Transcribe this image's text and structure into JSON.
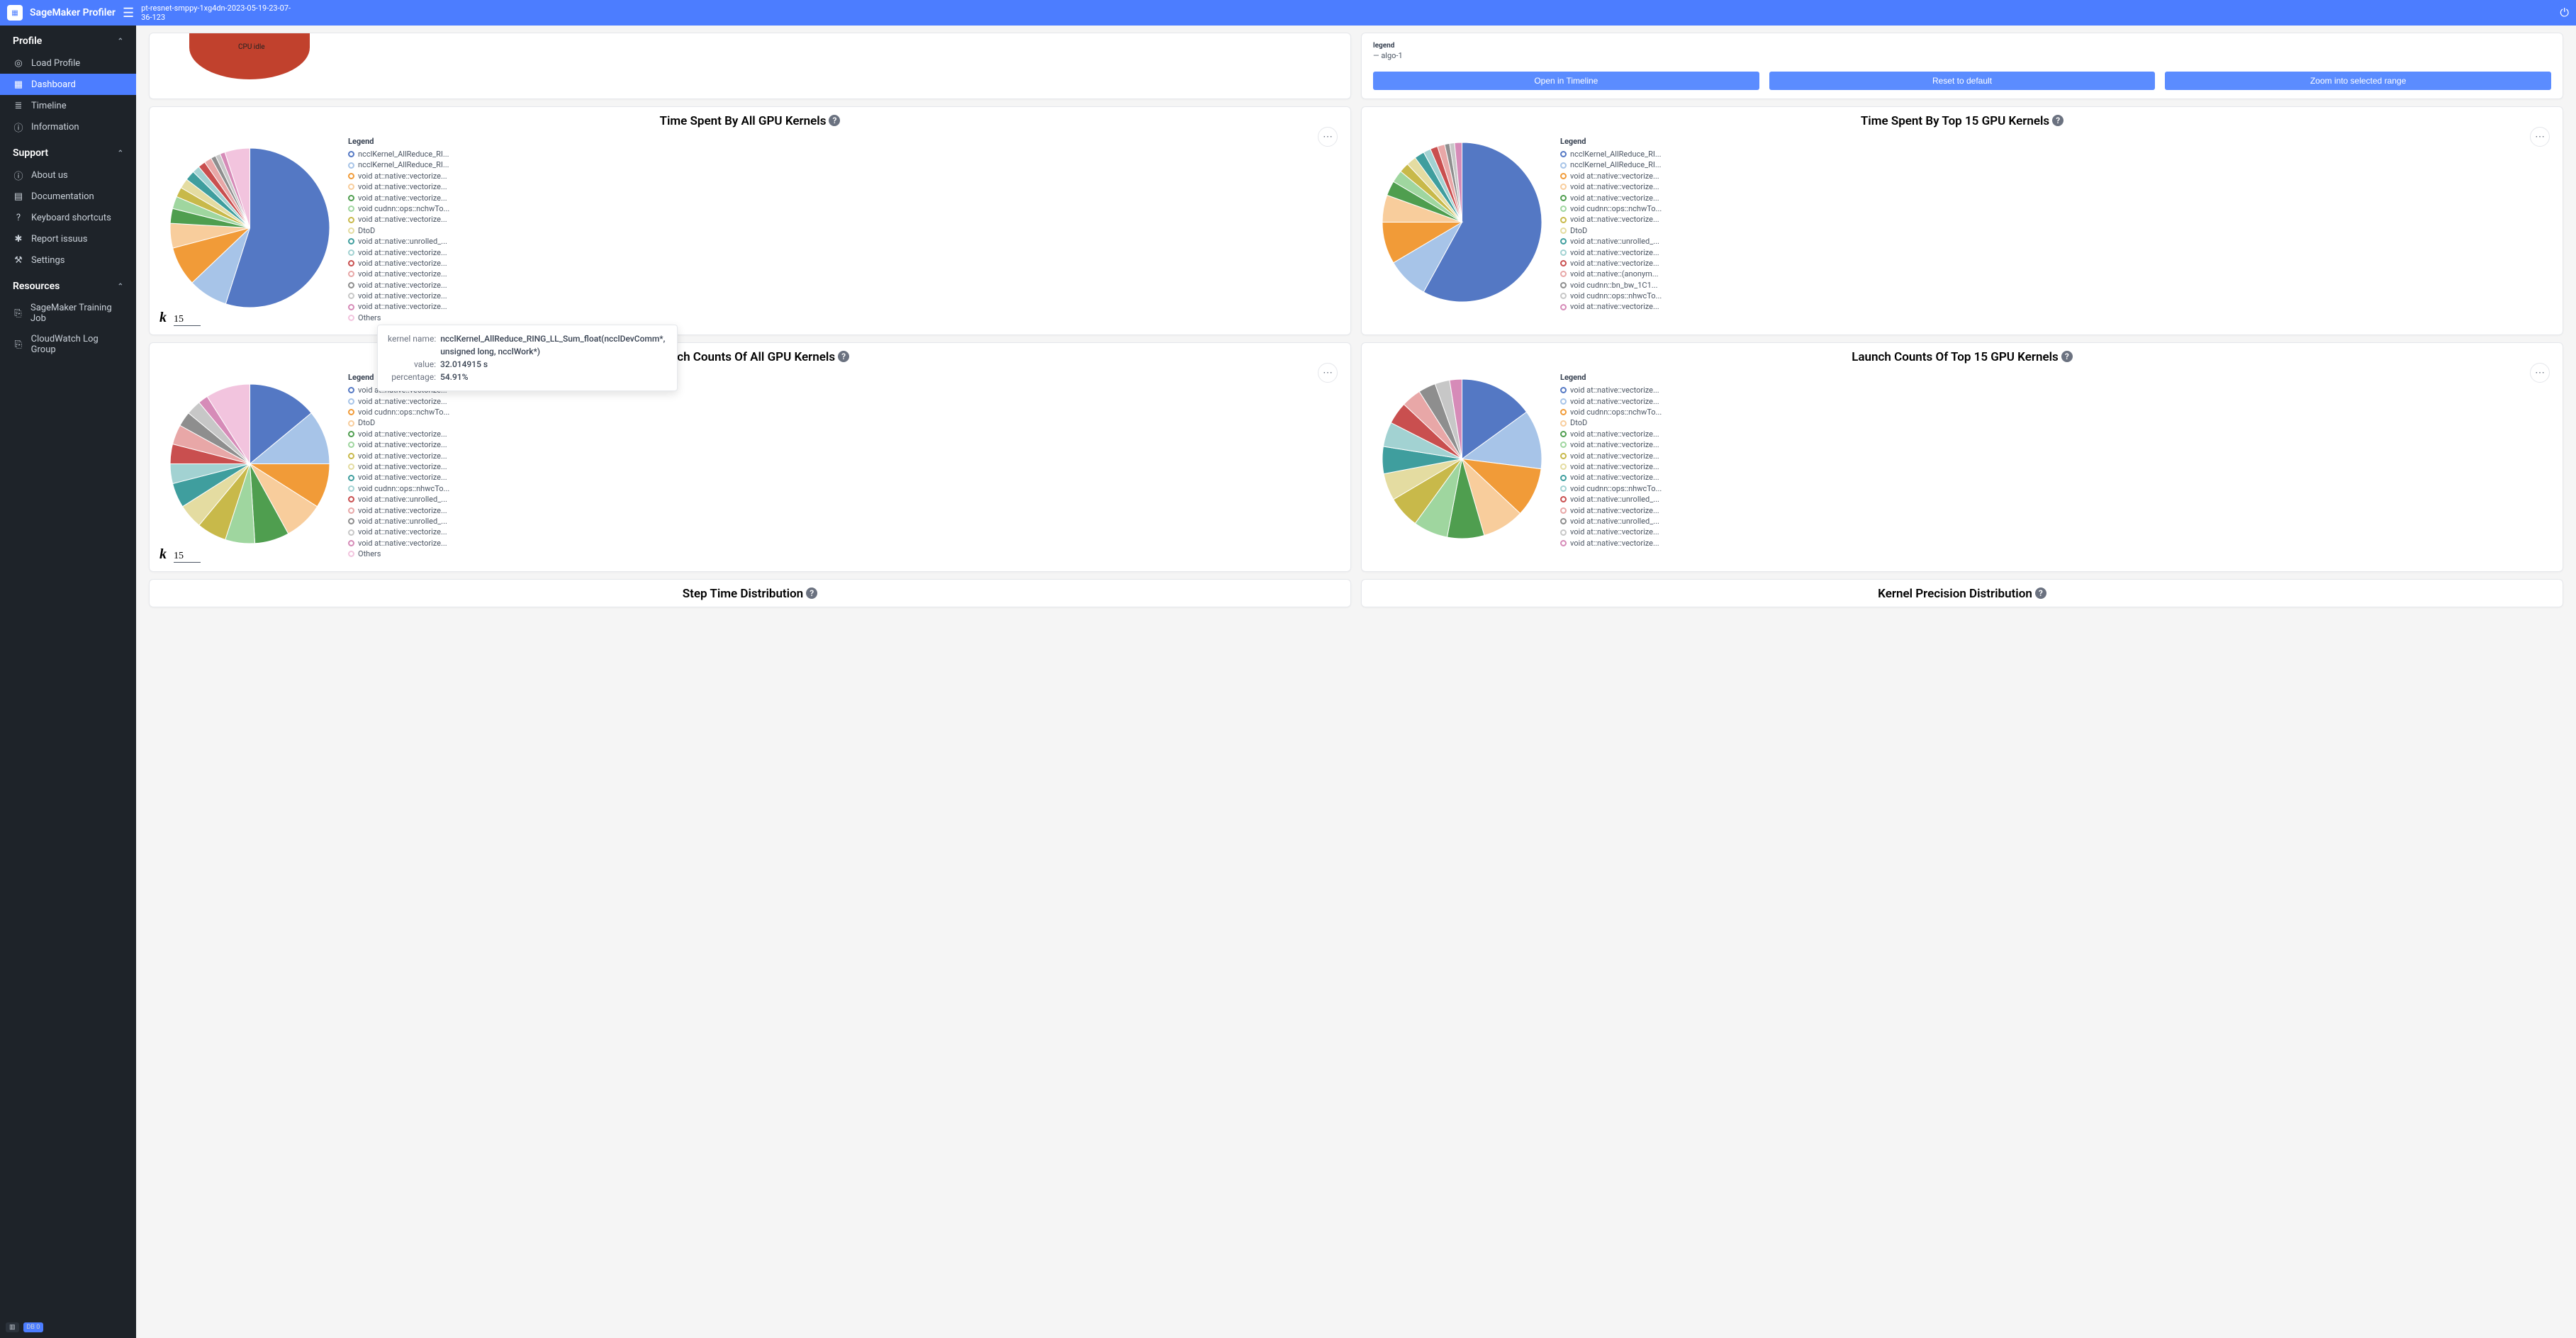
{
  "header": {
    "app_title": "SageMaker Profiler",
    "job_name": "pt-resnet-smppy-1xg4dn-2023-05-19-23-07-36-123"
  },
  "sidebar": {
    "sections": {
      "profile": "Profile",
      "support": "Support",
      "resources": "Resources"
    },
    "profile_items": [
      {
        "label": "Load Profile",
        "icon": "◎"
      },
      {
        "label": "Dashboard",
        "icon": "▦",
        "active": true
      },
      {
        "label": "Timeline",
        "icon": "≣"
      },
      {
        "label": "Information",
        "icon": "ⓘ"
      }
    ],
    "support_items": [
      {
        "label": "About us",
        "icon": "ⓘ"
      },
      {
        "label": "Documentation",
        "icon": "▤"
      },
      {
        "label": "Keyboard shortcuts",
        "icon": "?"
      },
      {
        "label": "Report issuus",
        "icon": "✱"
      },
      {
        "label": "Settings",
        "icon": "⚒"
      }
    ],
    "resource_items": [
      {
        "label": "SageMaker Training Job",
        "icon": "⎘"
      },
      {
        "label": "CloudWatch Log Group",
        "icon": "⎘"
      }
    ],
    "footer_db": "DB 0"
  },
  "top_left": {
    "cpu_label": "CPU idle"
  },
  "top_right": {
    "legend_title": "legend",
    "legend_item": "algo-1",
    "buttons": {
      "open": "Open in Timeline",
      "reset": "Reset to default",
      "zoom": "Zoom into selected range"
    }
  },
  "tooltip": {
    "rows": [
      {
        "label": "kernel name:",
        "value": "ncclKernel_AllReduce_RING_LL_Sum_float(ncclDevComm*, unsigned long, ncclWork*)"
      },
      {
        "label": "value:",
        "value": "32.014915 s"
      },
      {
        "label": "percentage:",
        "value": "54.91%"
      }
    ]
  },
  "charts": [
    {
      "id": "time-all",
      "title": "Time Spent By All GPU Kernels",
      "k_value": "15",
      "show_k": true,
      "show_others": true,
      "chart_data": {
        "type": "pie",
        "title": "Time Spent By All GPU Kernels",
        "series": [
          {
            "name": "ncclKernel_AllReduce_RI...",
            "value": 54.91,
            "color": "#5478c4"
          },
          {
            "name": "ncclKernel_AllReduce_RI...",
            "value": 8.0,
            "color": "#a7c4e8"
          },
          {
            "name": "void at::native::vectorize...",
            "value": 8.0,
            "color": "#f19b38"
          },
          {
            "name": "void at::native::vectorize...",
            "value": 5.0,
            "color": "#f8cd9c"
          },
          {
            "name": "void at::native::vectorize...",
            "value": 3.0,
            "color": "#4f9e4f"
          },
          {
            "name": "void cudnn::ops::nchwTo...",
            "value": 2.5,
            "color": "#9fd69f"
          },
          {
            "name": "void at::native::vectorize...",
            "value": 2.0,
            "color": "#c8b94a"
          },
          {
            "name": "DtoD",
            "value": 2.0,
            "color": "#e4dca1"
          },
          {
            "name": "void at::native::unrolled_...",
            "value": 2.0,
            "color": "#3f9e9e"
          },
          {
            "name": "void at::native::vectorize...",
            "value": 1.5,
            "color": "#a2d2d2"
          },
          {
            "name": "void at::native::vectorize...",
            "value": 1.5,
            "color": "#c94f4f"
          },
          {
            "name": "void at::native::vectorize...",
            "value": 1.5,
            "color": "#e8a7a7"
          },
          {
            "name": "void at::native::vectorize...",
            "value": 1.0,
            "color": "#8e8e8e"
          },
          {
            "name": "void at::native::vectorize...",
            "value": 1.0,
            "color": "#c7c7c7"
          },
          {
            "name": "void at::native::vectorize...",
            "value": 1.0,
            "color": "#d68bb8"
          },
          {
            "name": "Others",
            "value": 5.09,
            "color": "#f2c4de"
          }
        ]
      }
    },
    {
      "id": "time-top15",
      "title": "Time Spent By Top 15 GPU Kernels",
      "show_k": false,
      "show_others": false,
      "chart_data": {
        "type": "pie",
        "title": "Time Spent By Top 15 GPU Kernels",
        "series": [
          {
            "name": "ncclKernel_AllReduce_RI...",
            "value": 58.0,
            "color": "#5478c4"
          },
          {
            "name": "ncclKernel_AllReduce_RI...",
            "value": 8.5,
            "color": "#a7c4e8"
          },
          {
            "name": "void at::native::vectorize...",
            "value": 8.5,
            "color": "#f19b38"
          },
          {
            "name": "void at::native::vectorize...",
            "value": 5.5,
            "color": "#f8cd9c"
          },
          {
            "name": "void at::native::vectorize...",
            "value": 3.0,
            "color": "#4f9e4f"
          },
          {
            "name": "void cudnn::ops::nchwTo...",
            "value": 2.5,
            "color": "#9fd69f"
          },
          {
            "name": "void at::native::vectorize...",
            "value": 2.0,
            "color": "#c8b94a"
          },
          {
            "name": "DtoD",
            "value": 2.0,
            "color": "#e4dca1"
          },
          {
            "name": "void at::native::unrolled_...",
            "value": 2.0,
            "color": "#3f9e9e"
          },
          {
            "name": "void at::native::vectorize...",
            "value": 1.5,
            "color": "#a2d2d2"
          },
          {
            "name": "void at::native::vectorize...",
            "value": 1.5,
            "color": "#c94f4f"
          },
          {
            "name": "void at::native::(anonym...",
            "value": 1.5,
            "color": "#e8a7a7"
          },
          {
            "name": "void cudnn::bn_bw_1C1...",
            "value": 1.0,
            "color": "#8e8e8e"
          },
          {
            "name": "void cudnn::ops::nhwcTo...",
            "value": 1.0,
            "color": "#c7c7c7"
          },
          {
            "name": "void at::native::vectorize...",
            "value": 1.5,
            "color": "#d68bb8"
          }
        ]
      }
    },
    {
      "id": "launch-all",
      "title": "Launch Counts Of All GPU Kernels",
      "k_value": "15",
      "show_k": true,
      "show_others": true,
      "chart_data": {
        "type": "pie",
        "title": "Launch Counts Of All GPU Kernels",
        "series": [
          {
            "name": "void at::native::vectorize...",
            "value": 14.0,
            "color": "#5478c4"
          },
          {
            "name": "void at::native::vectorize...",
            "value": 11.0,
            "color": "#a7c4e8"
          },
          {
            "name": "void cudnn::ops::nchwTo...",
            "value": 9.0,
            "color": "#f19b38"
          },
          {
            "name": "DtoD",
            "value": 8.0,
            "color": "#f8cd9c"
          },
          {
            "name": "void at::native::vectorize...",
            "value": 7.0,
            "color": "#4f9e4f"
          },
          {
            "name": "void at::native::vectorize...",
            "value": 6.0,
            "color": "#9fd69f"
          },
          {
            "name": "void at::native::vectorize...",
            "value": 6.0,
            "color": "#c8b94a"
          },
          {
            "name": "void at::native::vectorize...",
            "value": 5.0,
            "color": "#e4dca1"
          },
          {
            "name": "void at::native::vectorize...",
            "value": 5.0,
            "color": "#3f9e9e"
          },
          {
            "name": "void cudnn::ops::nhwcTo...",
            "value": 4.0,
            "color": "#a2d2d2"
          },
          {
            "name": "void at::native::unrolled_...",
            "value": 4.0,
            "color": "#c94f4f"
          },
          {
            "name": "void at::native::vectorize...",
            "value": 4.0,
            "color": "#e8a7a7"
          },
          {
            "name": "void at::native::unrolled_...",
            "value": 3.0,
            "color": "#8e8e8e"
          },
          {
            "name": "void at::native::vectorize...",
            "value": 3.0,
            "color": "#c7c7c7"
          },
          {
            "name": "void at::native::vectorize...",
            "value": 2.0,
            "color": "#d68bb8"
          },
          {
            "name": "Others",
            "value": 9.0,
            "color": "#f2c4de"
          }
        ]
      }
    },
    {
      "id": "launch-top15",
      "title": "Launch Counts Of Top 15 GPU Kernels",
      "show_k": false,
      "show_others": false,
      "chart_data": {
        "type": "pie",
        "title": "Launch Counts Of Top 15 GPU Kernels",
        "series": [
          {
            "name": "void at::native::vectorize...",
            "value": 15.0,
            "color": "#5478c4"
          },
          {
            "name": "void at::native::vectorize...",
            "value": 12.0,
            "color": "#a7c4e8"
          },
          {
            "name": "void cudnn::ops::nchwTo...",
            "value": 10.0,
            "color": "#f19b38"
          },
          {
            "name": "DtoD",
            "value": 8.5,
            "color": "#f8cd9c"
          },
          {
            "name": "void at::native::vectorize...",
            "value": 7.5,
            "color": "#4f9e4f"
          },
          {
            "name": "void at::native::vectorize...",
            "value": 7.0,
            "color": "#9fd69f"
          },
          {
            "name": "void at::native::vectorize...",
            "value": 6.5,
            "color": "#c8b94a"
          },
          {
            "name": "void at::native::vectorize...",
            "value": 5.5,
            "color": "#e4dca1"
          },
          {
            "name": "void at::native::vectorize...",
            "value": 5.5,
            "color": "#3f9e9e"
          },
          {
            "name": "void cudnn::ops::nhwcTo...",
            "value": 5.0,
            "color": "#a2d2d2"
          },
          {
            "name": "void at::native::unrolled_...",
            "value": 4.5,
            "color": "#c94f4f"
          },
          {
            "name": "void at::native::vectorize...",
            "value": 4.0,
            "color": "#e8a7a7"
          },
          {
            "name": "void at::native::unrolled_...",
            "value": 3.5,
            "color": "#8e8e8e"
          },
          {
            "name": "void at::native::vectorize...",
            "value": 3.0,
            "color": "#c7c7c7"
          },
          {
            "name": "void at::native::vectorize...",
            "value": 2.5,
            "color": "#d68bb8"
          }
        ]
      }
    }
  ],
  "bottom_cards": [
    {
      "title": "Step Time Distribution"
    },
    {
      "title": "Kernel Precision Distribution"
    }
  ],
  "legend_heading": "Legend"
}
